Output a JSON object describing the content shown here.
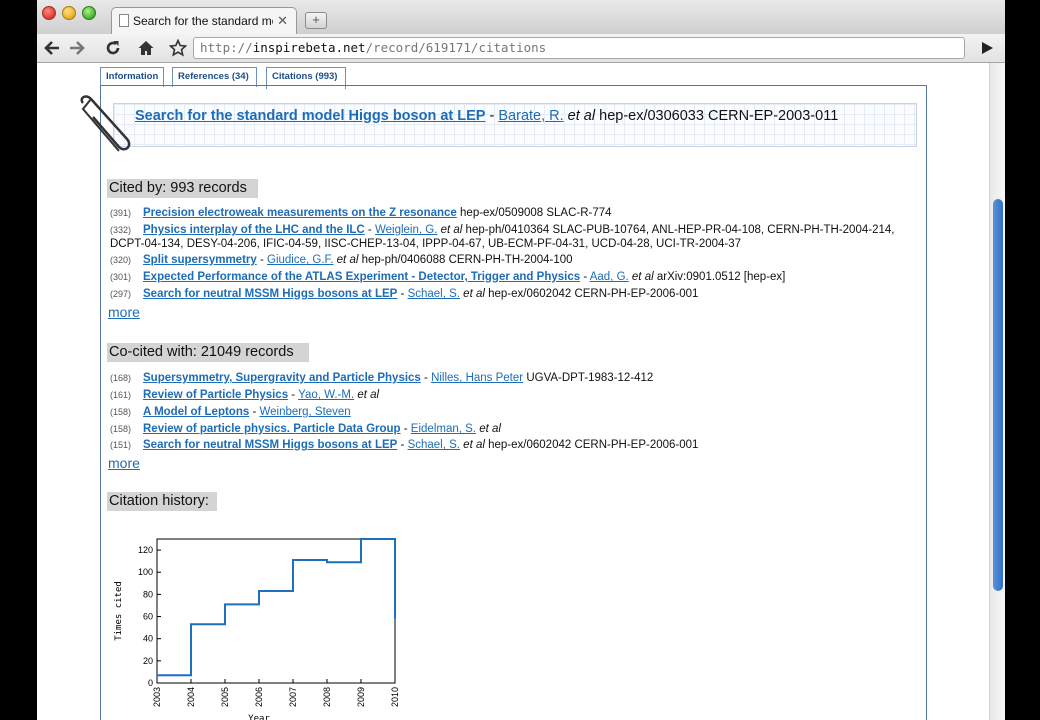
{
  "browser": {
    "tab_title": "Search for the standard mod",
    "tab_close": "✕",
    "new_tab": "+",
    "url_scheme": "http://",
    "url_host": "inspirebeta.net",
    "url_path": "/record/619171/citations"
  },
  "tabs": [
    "Information",
    "References (34)",
    "Citations (993)"
  ],
  "record": {
    "title": "Search for the standard model Higgs boson at LEP",
    "sep": " - ",
    "author": "Barate, R.",
    "etal": " et al ",
    "report": "hep-ex/0306033 CERN-EP-2003-011"
  },
  "cited_by": {
    "header": "Cited by: 993 records",
    "items": [
      {
        "count": "(391)",
        "title": "Precision electroweak measurements on the Z resonance",
        "author": "",
        "etal": "",
        "report": " hep-ex/0509008 SLAC-R-774"
      },
      {
        "count": "(332)",
        "title": "Physics interplay of the LHC and the ILC",
        "author": "Weiglein, G.",
        "etal": " et al ",
        "report": "hep-ph/0410364 SLAC-PUB-10764, ANL-HEP-PR-04-108, CERN-PH-TH-2004-214, DCPT-04-134, DESY-04-206, IFIC-04-59, IISC-CHEP-13-04, IPPP-04-67, UB-ECM-PF-04-31, UCD-04-28, UCI-TR-2004-37"
      },
      {
        "count": "(320)",
        "title": "Split supersymmetry",
        "author": "Giudice, G.F.",
        "etal": " et al ",
        "report": "hep-ph/0406088 CERN-PH-TH-2004-100"
      },
      {
        "count": "(301)",
        "title": "Expected Performance of the ATLAS Experiment - Detector, Trigger and Physics",
        "author": "Aad, G.",
        "etal": " et al ",
        "report": "arXiv:0901.0512 [hep-ex]"
      },
      {
        "count": "(297)",
        "title": "Search for neutral MSSM Higgs bosons at LEP",
        "author": "Schael, S.",
        "etal": " et al ",
        "report": "hep-ex/0602042 CERN-PH-EP-2006-001"
      }
    ],
    "more": "more"
  },
  "co_cited": {
    "header": "Co-cited with: 21049 records",
    "items": [
      {
        "count": "(168)",
        "title": "Supersymmetry, Supergravity and Particle Physics",
        "author": "Nilles, Hans Peter",
        "etal": " ",
        "report": "UGVA-DPT-1983-12-412"
      },
      {
        "count": "(161)",
        "title": "Review of Particle Physics",
        "author": "Yao, W.-M.",
        "etal": " et al",
        "report": ""
      },
      {
        "count": "(158)",
        "title": "A Model of Leptons",
        "author": "Weinberg, Steven",
        "etal": "",
        "report": ""
      },
      {
        "count": "(158)",
        "title": "Review of particle physics. Particle Data Group",
        "author": "Eidelman, S.",
        "etal": " et al",
        "report": ""
      },
      {
        "count": "(151)",
        "title": "Search for neutral MSSM Higgs bosons at LEP",
        "author": "Schael, S.",
        "etal": " et al ",
        "report": "hep-ex/0602042 CERN-PH-EP-2006-001"
      }
    ],
    "more": "more"
  },
  "history": {
    "header": "Citation history:"
  },
  "chart_data": {
    "type": "line",
    "step": true,
    "x": [
      2003,
      2004,
      2005,
      2006,
      2007,
      2008,
      2009,
      2010
    ],
    "y": [
      7,
      53,
      71,
      83,
      111,
      109,
      130,
      58
    ],
    "xlabel": "Year",
    "ylabel": "Times cited",
    "xlim": [
      2003,
      2010
    ],
    "ylim": [
      0,
      130
    ],
    "xticks": [
      "2003",
      "2004",
      "2005",
      "2006",
      "2007",
      "2008",
      "2009",
      "2010"
    ],
    "yticks": [
      "0",
      "20",
      "40",
      "60",
      "80",
      "100",
      "120"
    ],
    "color": "#1f6fbf",
    "grid": false
  }
}
